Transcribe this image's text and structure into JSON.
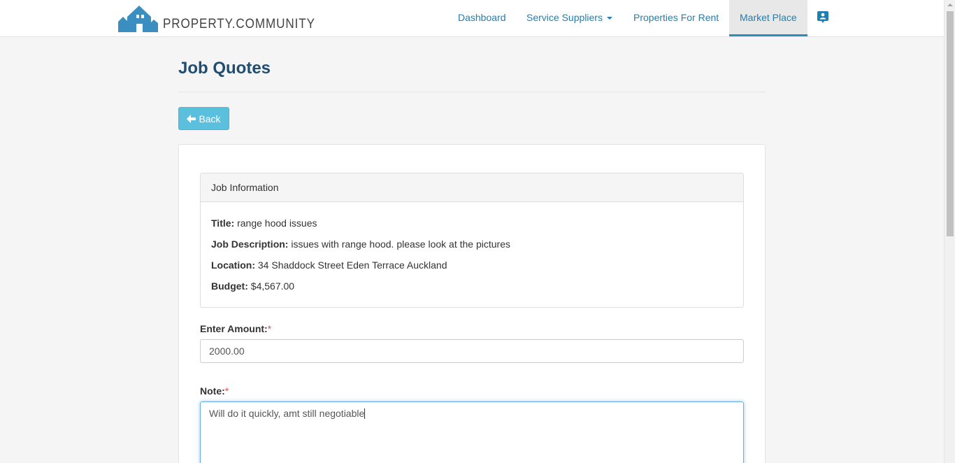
{
  "brand": {
    "name": "PROPERTY.COMMUNITY"
  },
  "nav": {
    "items": [
      {
        "label": "Dashboard"
      },
      {
        "label": "Service Suppliers"
      },
      {
        "label": "Properties For Rent"
      },
      {
        "label": "Market Place"
      }
    ],
    "active": "Market Place"
  },
  "page": {
    "title": "Job Quotes",
    "back_label": "Back"
  },
  "job_info": {
    "heading": "Job Information",
    "title_label": "Title:",
    "title_value": "range hood issues",
    "description_label": "Job Description:",
    "description_value": "issues with range hood. please look at the pictures",
    "location_label": "Location:",
    "location_value": "34 Shaddock Street Eden Terrace Auckland",
    "budget_label": "Budget:",
    "budget_value": "$4,567.00"
  },
  "form": {
    "amount_label": "Enter Amount:",
    "amount_value": "2000.00",
    "note_label": "Note:",
    "note_value": "Will do it quickly, amt still negotiable",
    "required_mark": "*"
  },
  "colors": {
    "brand": "#3a8fc0",
    "nav_link": "#1f7fb0",
    "title": "#1f4e72",
    "back_button": "#5bc0de",
    "required": "#d9534f"
  },
  "icons": {
    "back": "arrow-left-icon",
    "contact": "contact-card-icon",
    "dropdown": "caret-down-icon"
  }
}
